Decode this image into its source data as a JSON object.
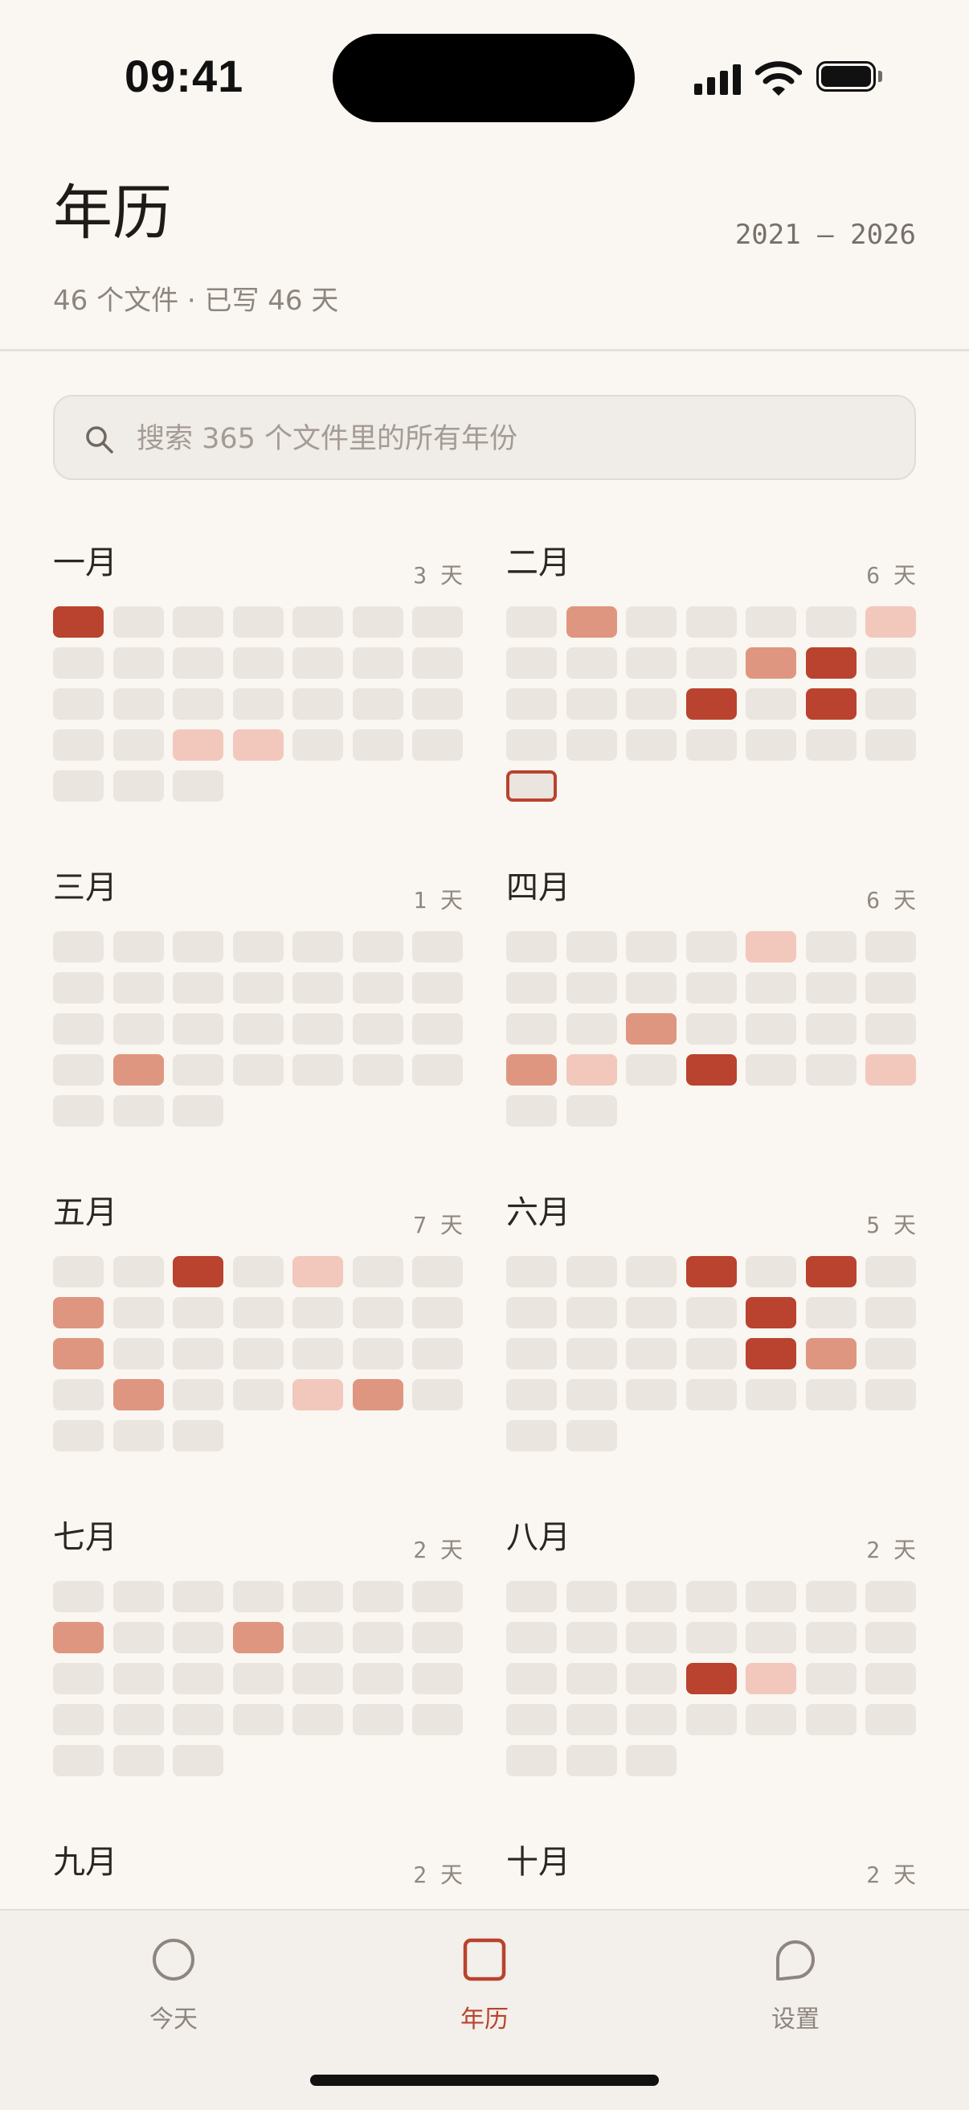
{
  "status_bar": {
    "time": "09:41"
  },
  "header": {
    "title": "年历",
    "year_range": "2021 — 2026",
    "subtitle": "46 个文件 · 已写 46 天"
  },
  "search": {
    "placeholder": "搜索 365 个文件里的所有年份",
    "value": ""
  },
  "colors": {
    "accent": "#B9432E",
    "level_1": "#F2C8BC",
    "level_2": "#DF9680",
    "level_3": "#B9432E",
    "empty": "#EAE5DF"
  },
  "months": [
    {
      "name": "一月",
      "count": "3 天",
      "days": [
        3,
        0,
        0,
        0,
        0,
        0,
        0,
        0,
        0,
        0,
        0,
        0,
        0,
        0,
        0,
        0,
        0,
        0,
        0,
        0,
        0,
        0,
        0,
        1,
        1,
        0,
        0,
        0,
        0,
        0,
        0
      ]
    },
    {
      "name": "二月",
      "count": "6 天",
      "days": [
        0,
        2,
        0,
        0,
        0,
        0,
        1,
        0,
        0,
        0,
        0,
        2,
        3,
        0,
        0,
        0,
        0,
        3,
        0,
        3,
        0,
        0,
        0,
        0,
        0,
        0,
        0,
        0,
        "today"
      ]
    },
    {
      "name": "三月",
      "count": "1 天",
      "days": [
        0,
        0,
        0,
        0,
        0,
        0,
        0,
        0,
        0,
        0,
        0,
        0,
        0,
        0,
        0,
        0,
        0,
        0,
        0,
        0,
        0,
        0,
        2,
        0,
        0,
        0,
        0,
        0,
        0,
        0,
        0
      ]
    },
    {
      "name": "四月",
      "count": "6 天",
      "days": [
        0,
        0,
        0,
        0,
        1,
        0,
        0,
        0,
        0,
        0,
        0,
        0,
        0,
        0,
        0,
        0,
        2,
        0,
        0,
        0,
        0,
        2,
        1,
        0,
        3,
        0,
        0,
        1,
        0,
        0
      ]
    },
    {
      "name": "五月",
      "count": "7 天",
      "days": [
        0,
        0,
        3,
        0,
        1,
        0,
        0,
        2,
        0,
        0,
        0,
        0,
        0,
        0,
        2,
        0,
        0,
        0,
        0,
        0,
        0,
        0,
        2,
        0,
        0,
        1,
        2,
        0,
        0,
        0,
        0
      ]
    },
    {
      "name": "六月",
      "count": "5 天",
      "days": [
        0,
        0,
        0,
        3,
        0,
        3,
        0,
        0,
        0,
        0,
        0,
        3,
        0,
        0,
        0,
        0,
        0,
        0,
        3,
        2,
        0,
        0,
        0,
        0,
        0,
        0,
        0,
        0,
        0,
        0
      ]
    },
    {
      "name": "七月",
      "count": "2 天",
      "days": [
        0,
        0,
        0,
        0,
        0,
        0,
        0,
        2,
        0,
        0,
        2,
        0,
        0,
        0,
        0,
        0,
        0,
        0,
        0,
        0,
        0,
        0,
        0,
        0,
        0,
        0,
        0,
        0,
        0,
        0,
        0
      ]
    },
    {
      "name": "八月",
      "count": "2 天",
      "days": [
        0,
        0,
        0,
        0,
        0,
        0,
        0,
        0,
        0,
        0,
        0,
        0,
        0,
        0,
        0,
        0,
        0,
        3,
        1,
        0,
        0,
        0,
        0,
        0,
        0,
        0,
        0,
        0,
        0,
        0,
        0
      ]
    },
    {
      "name": "九月",
      "count": "2 天",
      "days": []
    },
    {
      "name": "十月",
      "count": "2 天",
      "days": []
    }
  ],
  "tabs": [
    {
      "id": "today",
      "label": "今天",
      "icon": "circle-icon",
      "active": false
    },
    {
      "id": "calendar",
      "label": "年历",
      "icon": "square-icon",
      "active": true
    },
    {
      "id": "settings",
      "label": "设置",
      "icon": "speech-bubble-icon",
      "active": false
    }
  ]
}
